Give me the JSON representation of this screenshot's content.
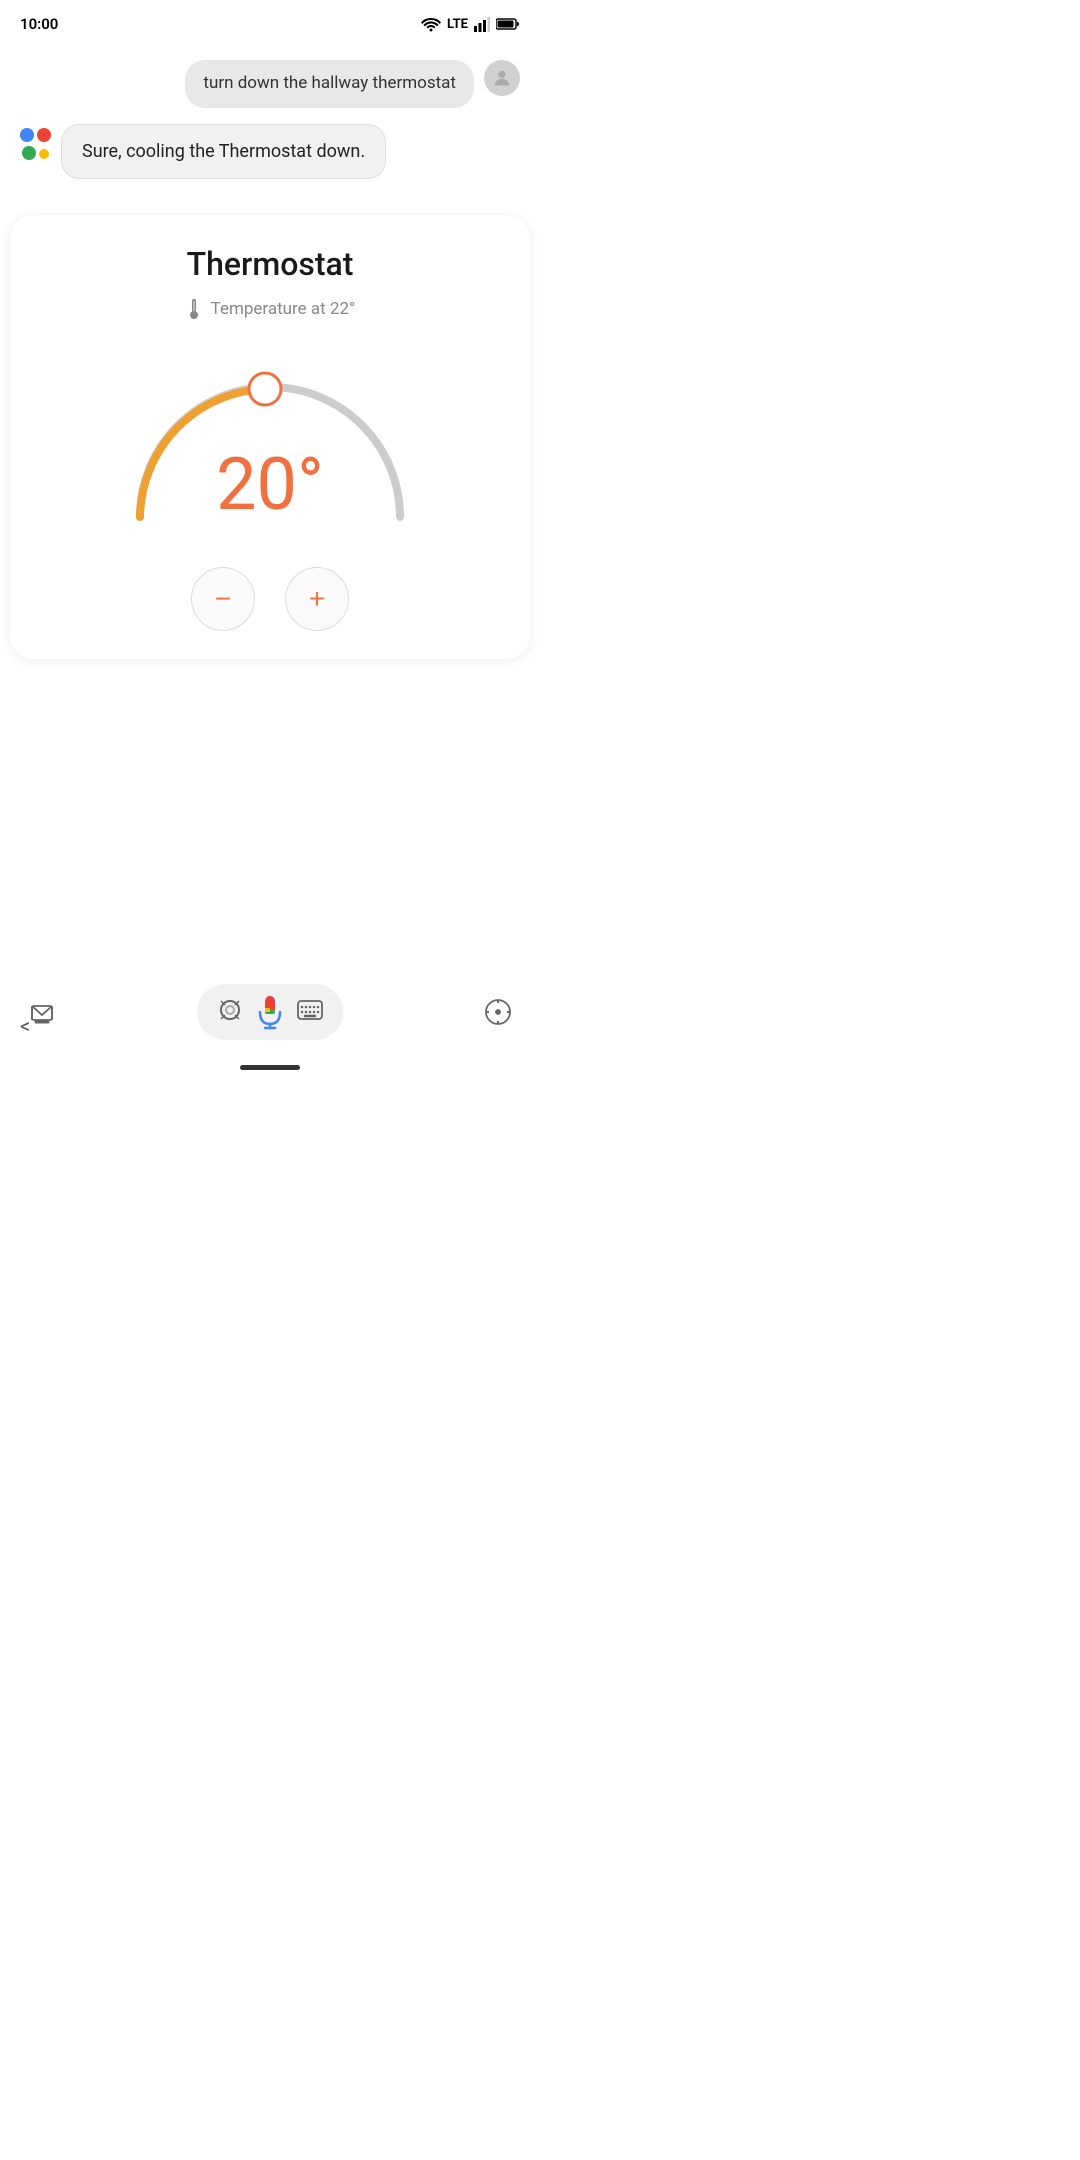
{
  "status": {
    "time": "10:00",
    "network": "LTE"
  },
  "chat": {
    "user_message": "turn down the hallway thermostat",
    "assistant_message": "Sure, cooling the Thermostat down."
  },
  "thermostat": {
    "title": "Thermostat",
    "temp_label": "Temperature at 22°",
    "current_temp": "20°",
    "min": 10,
    "max": 30,
    "value": 20,
    "total": 30,
    "colors": {
      "active": "#f0a030",
      "inactive": "#cccccc",
      "handle": "#f07040",
      "text": "#f07040"
    }
  },
  "controls": {
    "decrease_label": "−",
    "increase_label": "+"
  },
  "bottom_nav": {
    "items": [
      {
        "name": "notifications",
        "symbol": "📥"
      },
      {
        "name": "lens",
        "symbol": "◎"
      },
      {
        "name": "mic",
        "symbol": "🎤"
      },
      {
        "name": "keyboard",
        "symbol": "⌨"
      },
      {
        "name": "compass",
        "symbol": "◎"
      }
    ]
  },
  "back": "<"
}
